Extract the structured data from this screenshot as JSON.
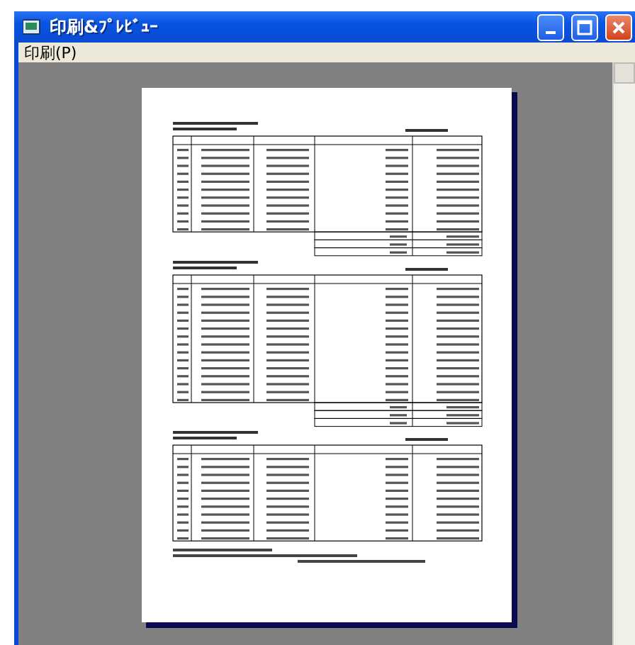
{
  "window": {
    "title": "印刷&ﾌﾟﾚﾋﾞｭｰ"
  },
  "menu": [
    {
      "label": "印刷(P)"
    }
  ]
}
